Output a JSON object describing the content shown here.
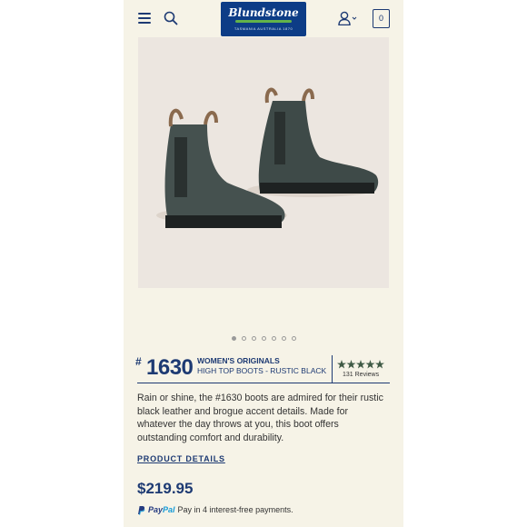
{
  "header": {
    "logo_text": "Blundstone",
    "logo_tagline": "TASMANIA AUSTRALIA 1870",
    "cart_count": "0",
    "icons": [
      "menu-icon",
      "search-icon",
      "account-icon",
      "cart-icon"
    ]
  },
  "gallery": {
    "image": "green rustic suede chelsea boots",
    "dots": 7,
    "active_dot": 1
  },
  "product": {
    "hash": "#",
    "number": "1630",
    "collection": "WOMEN'S ORIGINALS",
    "model": "HIGH TOP BOOTS - RUSTIC BLACK",
    "rating": 5,
    "reviews": "131 Reviews",
    "description_lines": [
      "Rain or shine, the #1630 boots are admired for their rustic",
      "black leather and brogue accent details. Made for",
      "whatever the day throws at you, this boot offers",
      "outstanding comfort and durability."
    ],
    "details_link": "PRODUCT DETAILS",
    "price": "$219.95"
  },
  "paypal": {
    "brand_pay": "Pay",
    "brand_pal": "Pal",
    "message": "Pay in 4 interest-free payments."
  },
  "colors": {
    "navy": "#1d3a73",
    "background": "#f6f3e7",
    "star": "#3f5a45",
    "logo_green": "#63b34a"
  }
}
